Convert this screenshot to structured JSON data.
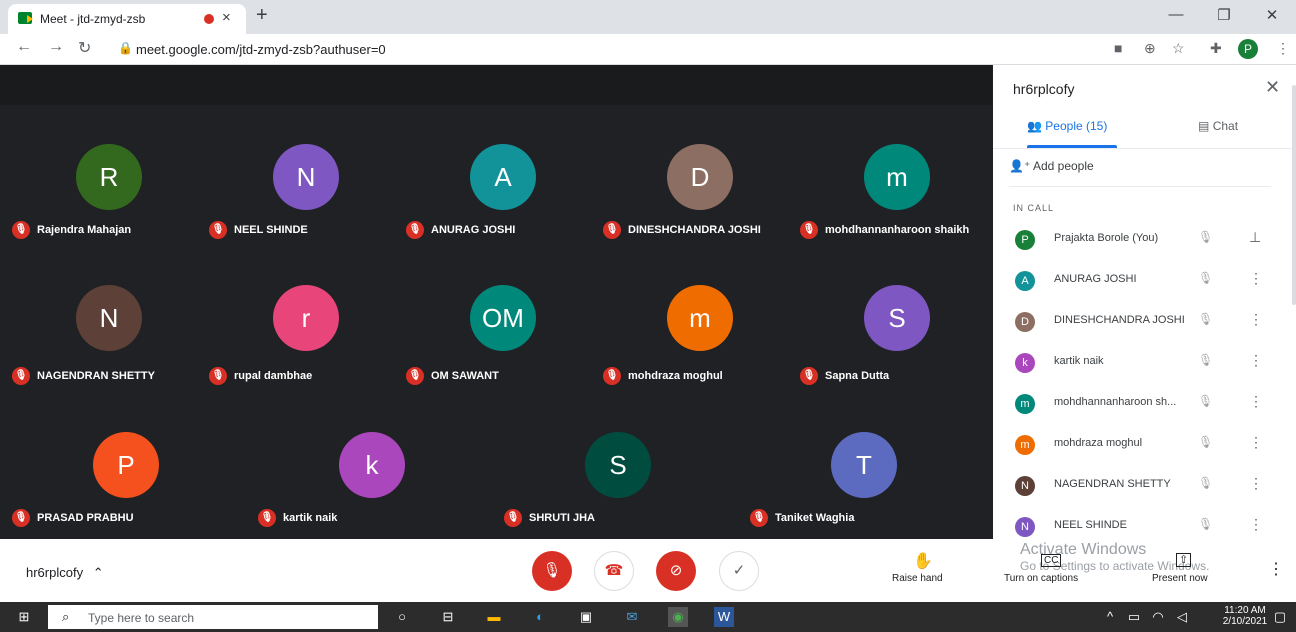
{
  "browser": {
    "tab_title": "Meet - jtd-zmyd-zsb",
    "new_tab": "+",
    "url": "meet.google.com/jtd-zmyd-zsb?authuser=0",
    "profile_initial": "P",
    "window_controls": {
      "minimize": "—",
      "restore": "❐",
      "close": "✕"
    }
  },
  "tiles_row1": [
    {
      "initial": "R",
      "name": "Rajendra Mahajan",
      "color": "#33691e"
    },
    {
      "initial": "N",
      "name": "NEEL SHINDE",
      "color": "#7e57c2"
    },
    {
      "initial": "A",
      "name": "ANURAG JOSHI",
      "color": "#12939a"
    },
    {
      "initial": "D",
      "name": "DINESHCHANDRA JOSHI",
      "color": "#8d6e63"
    },
    {
      "initial": "m",
      "name": "mohdhannanharoon shaikh",
      "color": "#00897b"
    }
  ],
  "tiles_row2": [
    {
      "initial": "N",
      "name": "NAGENDRAN SHETTY",
      "color": "#5d4037"
    },
    {
      "initial": "r",
      "name": "rupal dambhae",
      "color": "#e8457b"
    },
    {
      "initial": "OM",
      "name": "OM SAWANT",
      "color": "#00897b"
    },
    {
      "initial": "m",
      "name": "mohdraza moghul",
      "color": "#ef6c00"
    },
    {
      "initial": "S",
      "name": "Sapna Dutta",
      "color": "#7e57c2"
    }
  ],
  "tiles_row3": [
    {
      "initial": "P",
      "name": "PRASAD PRABHU",
      "color": "#f4511e"
    },
    {
      "initial": "k",
      "name": "kartik naik",
      "color": "#ab47bc"
    },
    {
      "initial": "S",
      "name": "SHRUTI JHA",
      "color": "#004d40"
    },
    {
      "initial": "T",
      "name": "Taniket Waghia",
      "color": "#5c6bc0"
    }
  ],
  "panel": {
    "title": "hr6rplcofy",
    "people_tab": "People (15)",
    "chat_tab": "Chat",
    "add_people": "Add people",
    "in_call": "IN CALL",
    "participants": [
      {
        "initial": "P",
        "name": "Prajakta Borole (You)",
        "color": "#188038"
      },
      {
        "initial": "A",
        "name": "ANURAG JOSHI",
        "color": "#12939a"
      },
      {
        "initial": "D",
        "name": "DINESHCHANDRA JOSHI",
        "color": "#8d6e63"
      },
      {
        "initial": "k",
        "name": "kartik naik",
        "color": "#ab47bc"
      },
      {
        "initial": "m",
        "name": "mohdhannanharoon sh...",
        "color": "#00897b"
      },
      {
        "initial": "m",
        "name": "mohdraza moghul",
        "color": "#ef6c00"
      },
      {
        "initial": "N",
        "name": "NAGENDRAN SHETTY",
        "color": "#5d4037"
      },
      {
        "initial": "N",
        "name": "NEEL SHINDE",
        "color": "#7e57c2"
      }
    ]
  },
  "bottom": {
    "meeting_code": "hr6rplcofy",
    "raise_hand": "Raise hand",
    "captions": "Turn on captions",
    "present": "Present now",
    "watermark_line1": "Activate Windows",
    "watermark_line2": "Go to Settings to activate Windows."
  },
  "taskbar": {
    "search_placeholder": "Type here to search",
    "time": "11:20 AM",
    "date": "2/10/2021"
  }
}
